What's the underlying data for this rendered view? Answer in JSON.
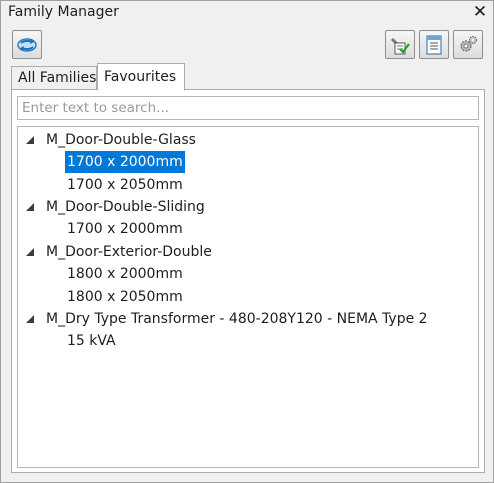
{
  "window": {
    "title": "Family Manager",
    "close_glyph": "✕"
  },
  "toolbar": {
    "buttons": [
      {
        "icon": "refresh-icon"
      },
      {
        "icon": "checklist-icon"
      },
      {
        "icon": "document-icon"
      },
      {
        "icon": "settings-icon"
      }
    ]
  },
  "tabs": [
    {
      "label": "All Families",
      "active": false
    },
    {
      "label": "Favourites",
      "active": true
    }
  ],
  "search": {
    "value": "",
    "placeholder": "Enter text to search..."
  },
  "tree": {
    "families": [
      {
        "name": "M_Door-Double-Glass",
        "expanded": true,
        "types": [
          "1700 x 2000mm",
          "1700 x 2050mm"
        ]
      },
      {
        "name": "M_Door-Double-Sliding",
        "expanded": true,
        "types": [
          "1700 x 2000mm"
        ]
      },
      {
        "name": "M_Door-Exterior-Double",
        "expanded": true,
        "types": [
          "1800 x 2000mm",
          "1800 x 2050mm"
        ]
      },
      {
        "name": "M_Dry Type Transformer - 480-208Y120 - NEMA Type 2",
        "expanded": true,
        "types": [
          "15 kVA"
        ]
      }
    ],
    "selected": "M_Door-Double-Glass / 1700 x 2000mm"
  },
  "colors": {
    "selection": "#0078d7",
    "window_bg": "#f0f0f0",
    "border": "#acacac"
  }
}
